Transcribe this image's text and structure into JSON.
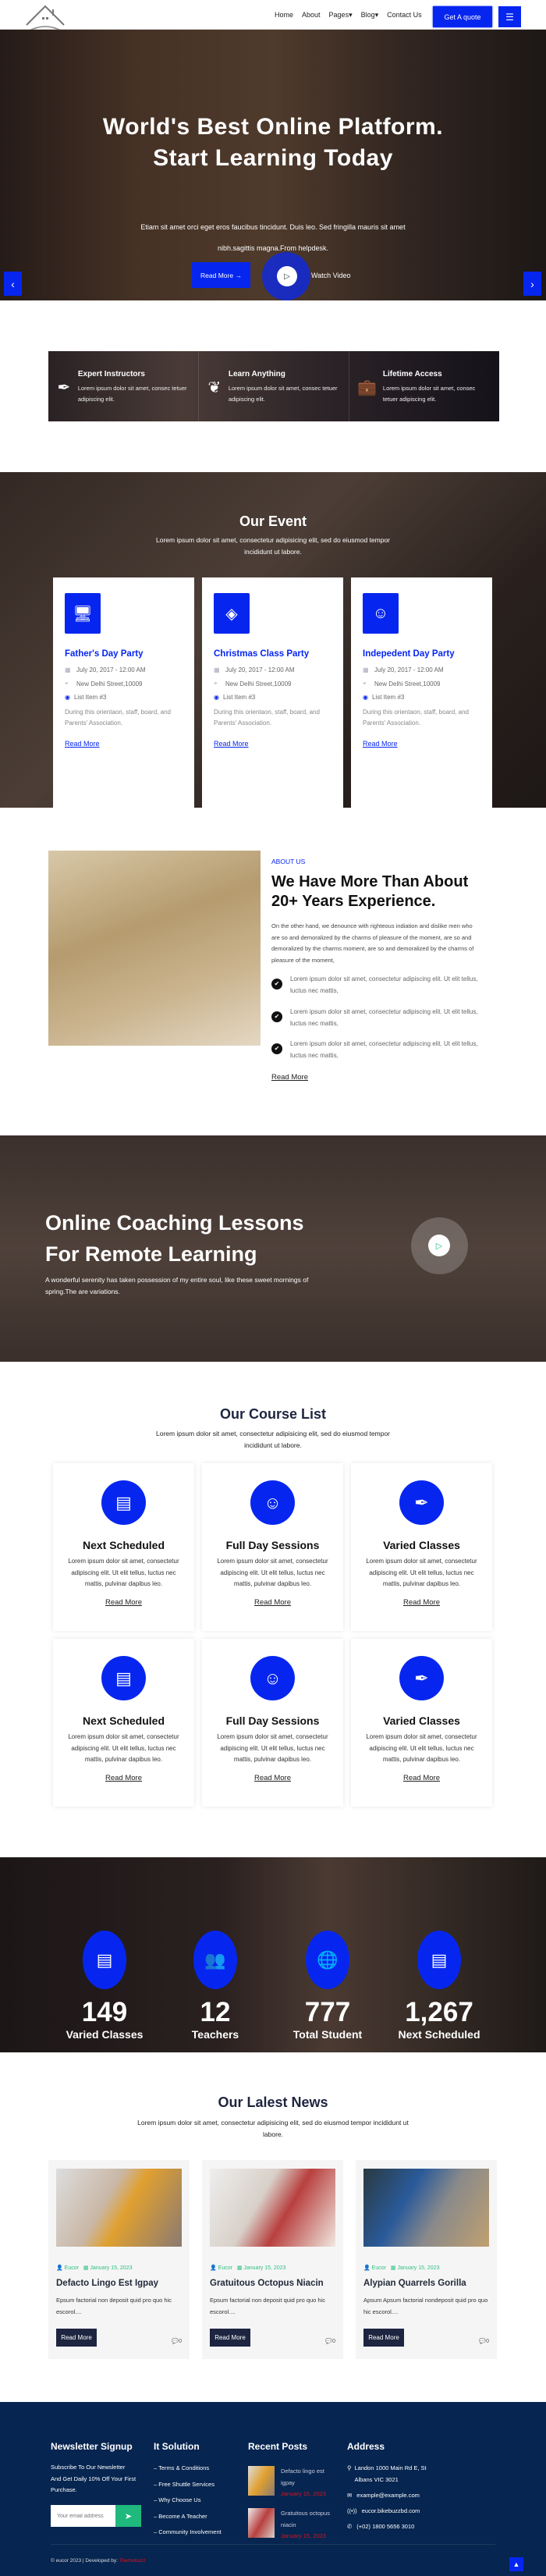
{
  "header": {
    "nav": [
      "Home",
      "About",
      "Pages",
      "Blog",
      "Contact Us"
    ],
    "quote_label": "Get A quote",
    "logo_text": "REAL ESTATE"
  },
  "hero": {
    "title_line1": "World's Best Online Platform.",
    "title_line2": "Start Learning Today",
    "subtitle": "Etiam sit amet orci eget eros faucibus tincidunt. Duis leo. Sed fringilla mauris sit amet nibh.sagittis magna.From helpdesk.",
    "read_more": "Read More →",
    "watch_video": "Watch Video"
  },
  "features": [
    {
      "title": "Expert Instructors",
      "text": "Lorem ipsum dolor sit amet, consec tetuer adipiscing elit.",
      "icon": "pen-tool-icon"
    },
    {
      "title": "Learn Anything",
      "text": "Lorem ipsum dolor sit amet, consec tetuer adipiscing elit.",
      "icon": "hands-brain-icon"
    },
    {
      "title": "Lifetime Access",
      "text": "Lorem ipsum dolor sit amet, consec tetuer adipiscing elit.",
      "icon": "briefcase-icon"
    }
  ],
  "event": {
    "title": "Our Event",
    "subtitle": "Lorem ipsum dolor sit amet, consectetur adipisicing elit, sed do eiusmod tempor incididunt ut labore.",
    "cards": [
      {
        "title": "Father's Day Party",
        "date": "July 20, 2017 - 12:00 AM",
        "location": "New Delhi Street,10009",
        "item": "List Item #3",
        "text": "During this orientaon, staff, board, and Parents' Association.",
        "link": "Read More"
      },
      {
        "title": "Christmas Class Party",
        "date": "July 20, 2017 - 12:00 AM",
        "location": "New Delhi Street,10009",
        "item": "List Item #3",
        "text": "During this orientaon, staff, board, and Parents' Association.",
        "link": "Read More"
      },
      {
        "title": "Indepedent Day Party",
        "date": "July 20, 2017 - 12:00 AM",
        "location": "New Delhi Street,10009",
        "item": "List Item #3",
        "text": "During this orientaon, staff, board, and Parents' Association.",
        "link": "Read More"
      }
    ]
  },
  "about": {
    "tag": "ABOUT US",
    "title_line1": "We Have More Than About",
    "title_line2": "20+ Years Experience.",
    "body": "On the other hand, we denounce with righteous indiation and dislike men who are so and demoralized by the charms of pleasure of the moment, are so and demoralized by the charms  moment, are so and demoralized by the charms of pleasure of the moment,",
    "checks": [
      "Lorem ipsum dolor sit amet, consectetur adipiscing elit. Ut elit tellus, luctus nec mattis,",
      "Lorem ipsum dolor sit amet, consectetur adipiscing elit. Ut elit tellus, luctus nec mattis,",
      "Lorem ipsum dolor sit amet, consectetur adipiscing elit. Ut elit tellus, luctus nec mattis,"
    ],
    "link": "Read More"
  },
  "coaching": {
    "title_line1": "Online Coaching Lessons",
    "title_line2": "For Remote Learning",
    "text": "A wonderful serenity has taken possession of my entire soul, like these sweet mornings of spring.The are variations."
  },
  "courses": {
    "title": "Our Course List",
    "subtitle": "Lorem ipsum dolor sit amet, consectetur adipisicing elit, sed do eiusmod tempor incididunt ut labore.",
    "cards": [
      {
        "title": "Next Scheduled",
        "text": "Lorem ipsum dolor sit amet, consectetur adipiscing elit. Ut elit tellus, luctus nec mattis, pulvinar dapibus leo.",
        "link": "Read More"
      },
      {
        "title": "Full Day Sessions",
        "text": "Lorem ipsum dolor sit amet, consectetur adipiscing elit. Ut elit tellus, luctus nec mattis, pulvinar dapibus leo.",
        "link": "Read More"
      },
      {
        "title": "Varied Classes",
        "text": "Lorem ipsum dolor sit amet, consectetur adipiscing elit. Ut elit tellus, luctus nec mattis, pulvinar dapibus leo.",
        "link": "Read More"
      },
      {
        "title": "Next Scheduled",
        "text": "Lorem ipsum dolor sit amet, consectetur adipiscing elit. Ut elit tellus, luctus nec mattis, pulvinar dapibus leo.",
        "link": "Read More"
      },
      {
        "title": "Full Day Sessions",
        "text": "Lorem ipsum dolor sit amet, consectetur adipiscing elit. Ut elit tellus, luctus nec mattis, pulvinar dapibus leo.",
        "link": "Read More"
      },
      {
        "title": "Varied Classes",
        "text": "Lorem ipsum dolor sit amet, consectetur adipiscing elit. Ut elit tellus, luctus nec mattis, pulvinar dapibus leo.",
        "link": "Read More"
      }
    ]
  },
  "stats": [
    {
      "value": "149",
      "label": "Varied Classes"
    },
    {
      "value": "12",
      "label": "Teachers"
    },
    {
      "value": "777",
      "label": "Total Student"
    },
    {
      "value": "1,267",
      "label": "Next Scheduled"
    }
  ],
  "news": {
    "title": "Our Lalest News",
    "subtitle": "Lorem ipsum dolor sit amet, consectetur adipisicing elit, sed do eiusmod tempor incididunt ut labore.",
    "cards": [
      {
        "author": "Eucor",
        "date": "January 15, 2023",
        "title": "Defacto Lingo Est Igpay",
        "text": "Epsum factorial non deposit quid pro quo hic escorol....",
        "button": "Read More",
        "comments": "0"
      },
      {
        "author": "Eucor",
        "date": "January 15, 2023",
        "title": "Gratuitous Octopus Niacin",
        "text": "Epsum factorial non deposit quid pro quo hic escorol....",
        "button": "Read More",
        "comments": "0"
      },
      {
        "author": "Eucor",
        "date": "January 15, 2023",
        "title": "Alypian Quarrels Gorilla",
        "text": "Apsum Apsum factorial nondeposit quid pro quo hic escorol....",
        "button": "Read More",
        "comments": "0"
      }
    ]
  },
  "footer": {
    "newsletter_title": "Newsletter Signup",
    "newsletter_text": "Subscribe To Our Newsletter And Get Daily 10% Off Your First Purchase.",
    "email_placeholder": "Your email address",
    "links_title": "It Solution",
    "links": [
      "Terms & Conditions",
      "Free Shuttle Services",
      "Why Choose Us",
      "Become A Teacher",
      "Community Involvement"
    ],
    "posts_title": "Recent Posts",
    "posts": [
      {
        "title": "Defacto lingo est igpay",
        "date": "January 15, 2023"
      },
      {
        "title": "Gratuitous octopus niacin",
        "date": "January 15, 2023"
      }
    ],
    "address_title": "Address",
    "address": "Landon 1000 Main Rd E, St Albans VIC 3021",
    "email": "example@example.com",
    "website": "eucor.bikebuzzbd.com",
    "phone": "(+02) 1800 5656 3010",
    "copyright": "© eucor 2023 | Developed by: ",
    "developer": "Themebuzz"
  },
  "colors": {
    "accent": "#0626f0",
    "footer_bg": "#062550",
    "green": "#1fb97e",
    "developer_red": "#e0101a"
  }
}
